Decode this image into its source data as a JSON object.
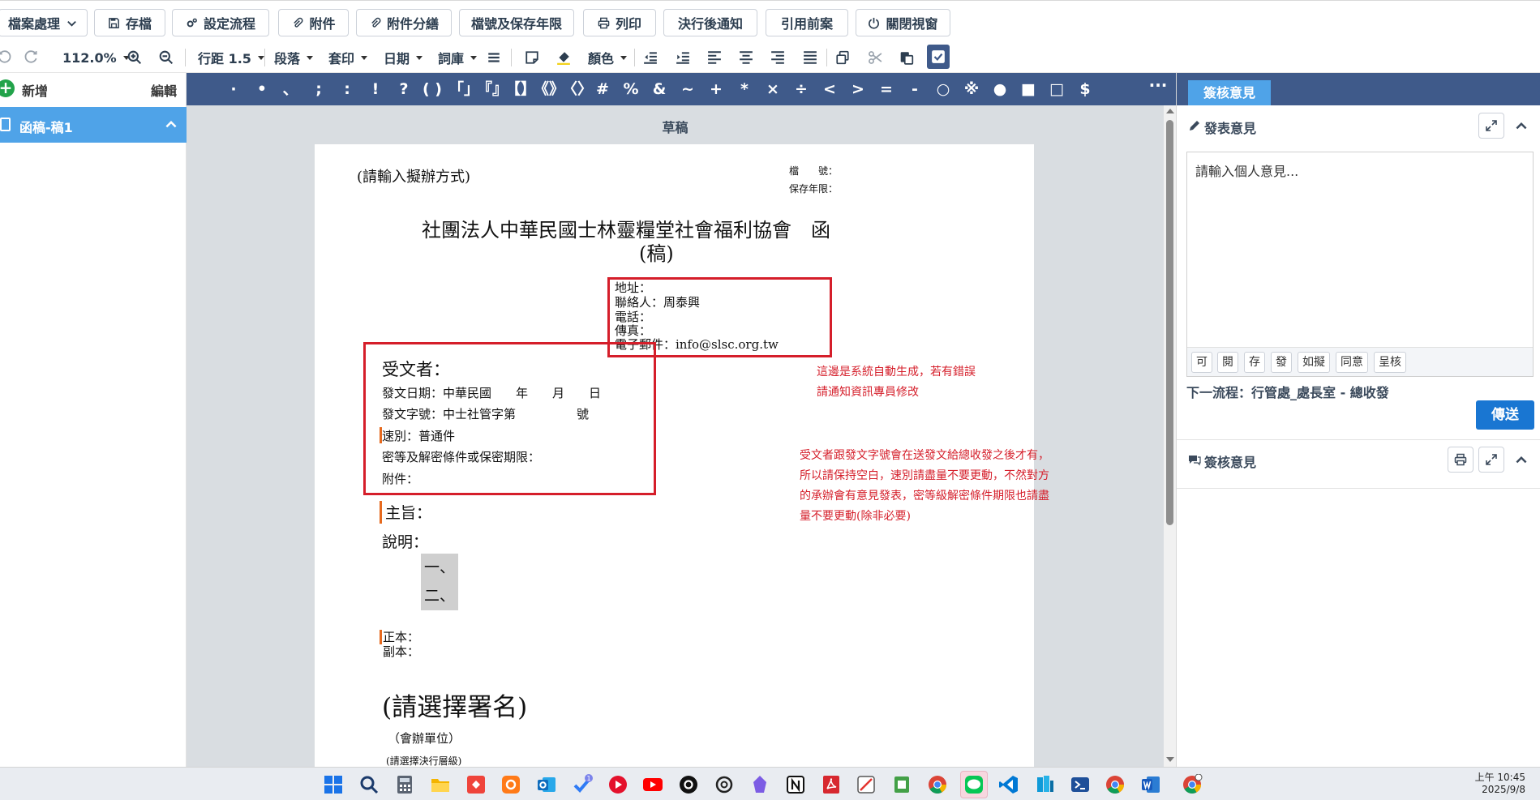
{
  "toolbar": {
    "file_menu": "檔案處理",
    "save": "存檔",
    "set_flow": "設定流程",
    "attachment": "附件",
    "attachment_split": "附件分繕",
    "file_no_retention": "檔號及保存年限",
    "print": "列印",
    "notify_after": "決行後通知",
    "cite_case": "引用前案",
    "close_window": "關閉視窗"
  },
  "edit_toolbar": {
    "zoom": "112.0%",
    "line_spacing": "行距 1.5",
    "paragraph": "段落",
    "stamp": "套印",
    "date": "日期",
    "phrases": "詞庫",
    "color": "顏色"
  },
  "left_panel": {
    "add_label": "新增",
    "edit_label": "編輯",
    "doc_item": "函稿-稿1"
  },
  "symbols": [
    "·",
    "•",
    "、",
    ";",
    ":",
    "!",
    "?",
    "( )",
    "「」",
    "『』",
    "【】",
    "《》",
    "〈〉",
    "#",
    "%",
    "&",
    "~",
    "+",
    "*",
    "×",
    "÷",
    "<",
    ">",
    "=",
    "-",
    "○",
    "※",
    "●",
    "■",
    "□",
    "$"
  ],
  "symbols_more": "···",
  "editor": {
    "title": "草稿",
    "method_prompt": "(請輸入擬辦方式)",
    "file_no_label": "檔　　號：",
    "retention_label": "保存年限：",
    "org_title": "社團法人中華民國士林靈糧堂社會福利協會　函",
    "draft_mark": "(稿)",
    "address": "地址：",
    "contact": "聯絡人：周泰興",
    "phone": "電話：",
    "fax": "傳真：",
    "email": "電子郵件：info@slsc.org.tw",
    "recipient": "受文者：",
    "issue_date": "發文日期：中華民國　　年　　月　　日",
    "issue_no": "發文字號：中士社管字第　　　　　號",
    "speed": "速別：普通件",
    "secrecy": "密等及解密條件或保密期限：",
    "attachments": "附件：",
    "subject": "主旨：",
    "explanation": "說明：",
    "item1": "一、",
    "item2": "二、",
    "main_copy": "正本：",
    "cc_copy": "副本：",
    "signature_prompt": "(請選擇署名)",
    "co_unit": "（會辦單位）",
    "exec_level": "(請選擇決行層級)",
    "note1_line1": "這邊是系統自動生成，若有錯誤",
    "note1_line2": "請通知資訊專員修改",
    "note2_line1": "受文者跟發文字號會在送發文給總收發之後才有，",
    "note2_line2": "所以請保持空白，速別請盡量不要更動，不然對方",
    "note2_line3": "的承辦會有意見發表，密等級解密條件期限也請盡",
    "note2_line4": "量不要更動(除非必要)"
  },
  "right_panel": {
    "tab": "簽核意見",
    "publish_opinion": "發表意見",
    "opinion_placeholder": "請輸入個人意見...",
    "quick_buttons": [
      "可",
      "閱",
      "存",
      "發",
      "如擬",
      "同意",
      "呈核"
    ],
    "next_flow": "下一流程：行管處_處長室 - 總收發",
    "send": "傳送",
    "review_opinions": "簽核意見"
  },
  "taskbar": {
    "time_period": "上午 10:45",
    "date": "2025/9/8",
    "badge": "1"
  },
  "colors": {
    "nav_blue": "#3f5a8a",
    "active_blue": "#4fa3e8",
    "send_blue": "#1976d2",
    "annotation_red": "#d51e2a"
  }
}
